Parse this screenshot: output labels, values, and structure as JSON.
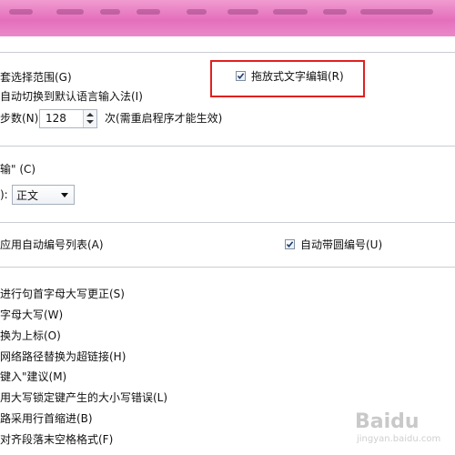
{
  "editing": {
    "smart_select_label": "套选择范围(G)",
    "auto_switch_ime_label": "自动切换到默认语言输入法(I)",
    "drag_drop_label": "拖放式文字编辑(R)",
    "drag_drop_checked": true,
    "undo_steps_label": "步数(N):",
    "undo_steps_value": "128",
    "undo_steps_note": "次(需重启程序才能生效)"
  },
  "input": {
    "section_label": "输\" (C)",
    "style_label": "):",
    "style_value": "正文"
  },
  "numbering": {
    "auto_list_label": "应用自动编号列表(A)",
    "circled_number_label": "自动带圆编号(U)",
    "circled_number_checked": true
  },
  "autocorrect": {
    "items": [
      "进行句首字母大写更正(S)",
      "字母大写(W)",
      "换为上标(O)",
      "网络路径替换为超链接(H)",
      "键入\"建议(M)",
      "用大写锁定键产生的大小写错误(L)",
      "路采用行首缩进(B)",
      "对齐段落末空格格式(F)"
    ]
  },
  "watermark": {
    "text": "Baidu",
    "sub": "jingyan.baidu.com"
  }
}
